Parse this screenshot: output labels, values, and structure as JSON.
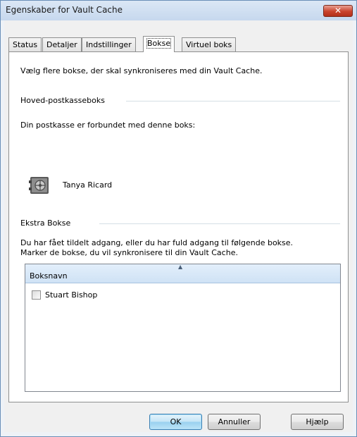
{
  "window": {
    "title": "Egenskaber for Vault Cache",
    "close_glyph": "✕"
  },
  "tabs": [
    {
      "label": "Status"
    },
    {
      "label": "Detaljer"
    },
    {
      "label": "Indstillinger"
    },
    {
      "label": "Bokse",
      "active": true
    },
    {
      "label": "Virtuel boks"
    }
  ],
  "panel": {
    "intro": "Vælg flere bokse, der skal synkroniseres med din Vault Cache.",
    "main_group": {
      "title": "Hoved-postkasseboks",
      "description": "Din postkasse er forbundet med denne boks:",
      "owner": "Tanya Ricard",
      "icon": "vault-icon"
    },
    "extra_group": {
      "title": "Ekstra Bokse",
      "description_line1": "Du har fået tildelt adgang, eller du har fuld adgang til følgende bokse.",
      "description_line2": "Marker de bokse, du vil synkronisere til din Vault Cache."
    },
    "list": {
      "header": "Boksnavn",
      "sort_glyph": "▲",
      "items": [
        {
          "label": "Stuart Bishop",
          "checked": false
        }
      ]
    }
  },
  "buttons": {
    "ok": "OK",
    "cancel": "Annuller",
    "help": "Hjælp"
  },
  "colors": {
    "title_bar": "#c6d8ee",
    "close_red": "#c9432c",
    "header_blue": "#cfe2f5"
  }
}
